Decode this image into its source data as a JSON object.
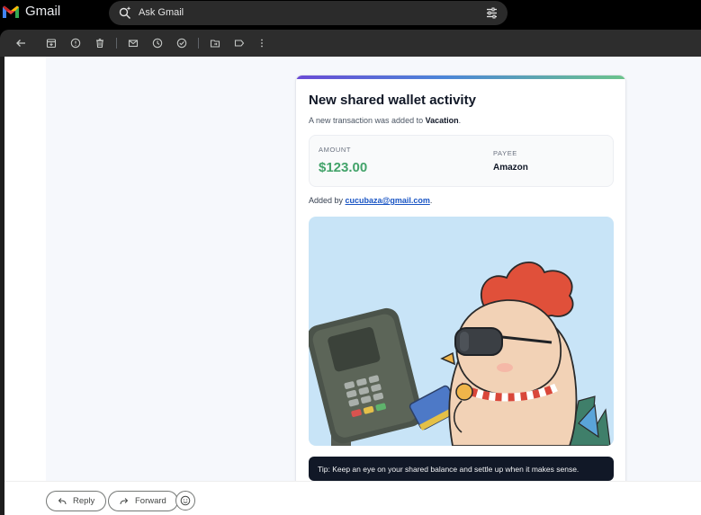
{
  "app": {
    "name": "Gmail"
  },
  "search": {
    "placeholder": "Ask Gmail"
  },
  "toolbar": {
    "icons": [
      "back-icon",
      "archive-icon",
      "report-spam-icon",
      "delete-icon",
      "mark-unread-icon",
      "snooze-icon",
      "add-task-icon",
      "move-to-icon",
      "label-icon",
      "more-vert-icon"
    ]
  },
  "email": {
    "title": "New shared wallet activity",
    "subtitle_prefix": "A new transaction was added to ",
    "wallet_name": "Vacation",
    "subtitle_suffix": ".",
    "amount_label": "AMOUNT",
    "amount_value": "$123.00",
    "payee_label": "PAYEE",
    "payee_value": "Amazon",
    "added_by_prefix": "Added by ",
    "added_by_email": "cucubaza@gmail.com",
    "added_by_suffix": ".",
    "tip": "Tip: Keep an eye on your shared balance and settle up when it makes sense."
  },
  "reply_bar": {
    "reply_label": "Reply",
    "forward_label": "Forward",
    "emoji_icon": "emoji-icon"
  },
  "colors": {
    "amount": "#43a36a",
    "link": "#1a55c4",
    "tip_bg": "#111827",
    "illustration_bg": "#c8e4f7"
  }
}
